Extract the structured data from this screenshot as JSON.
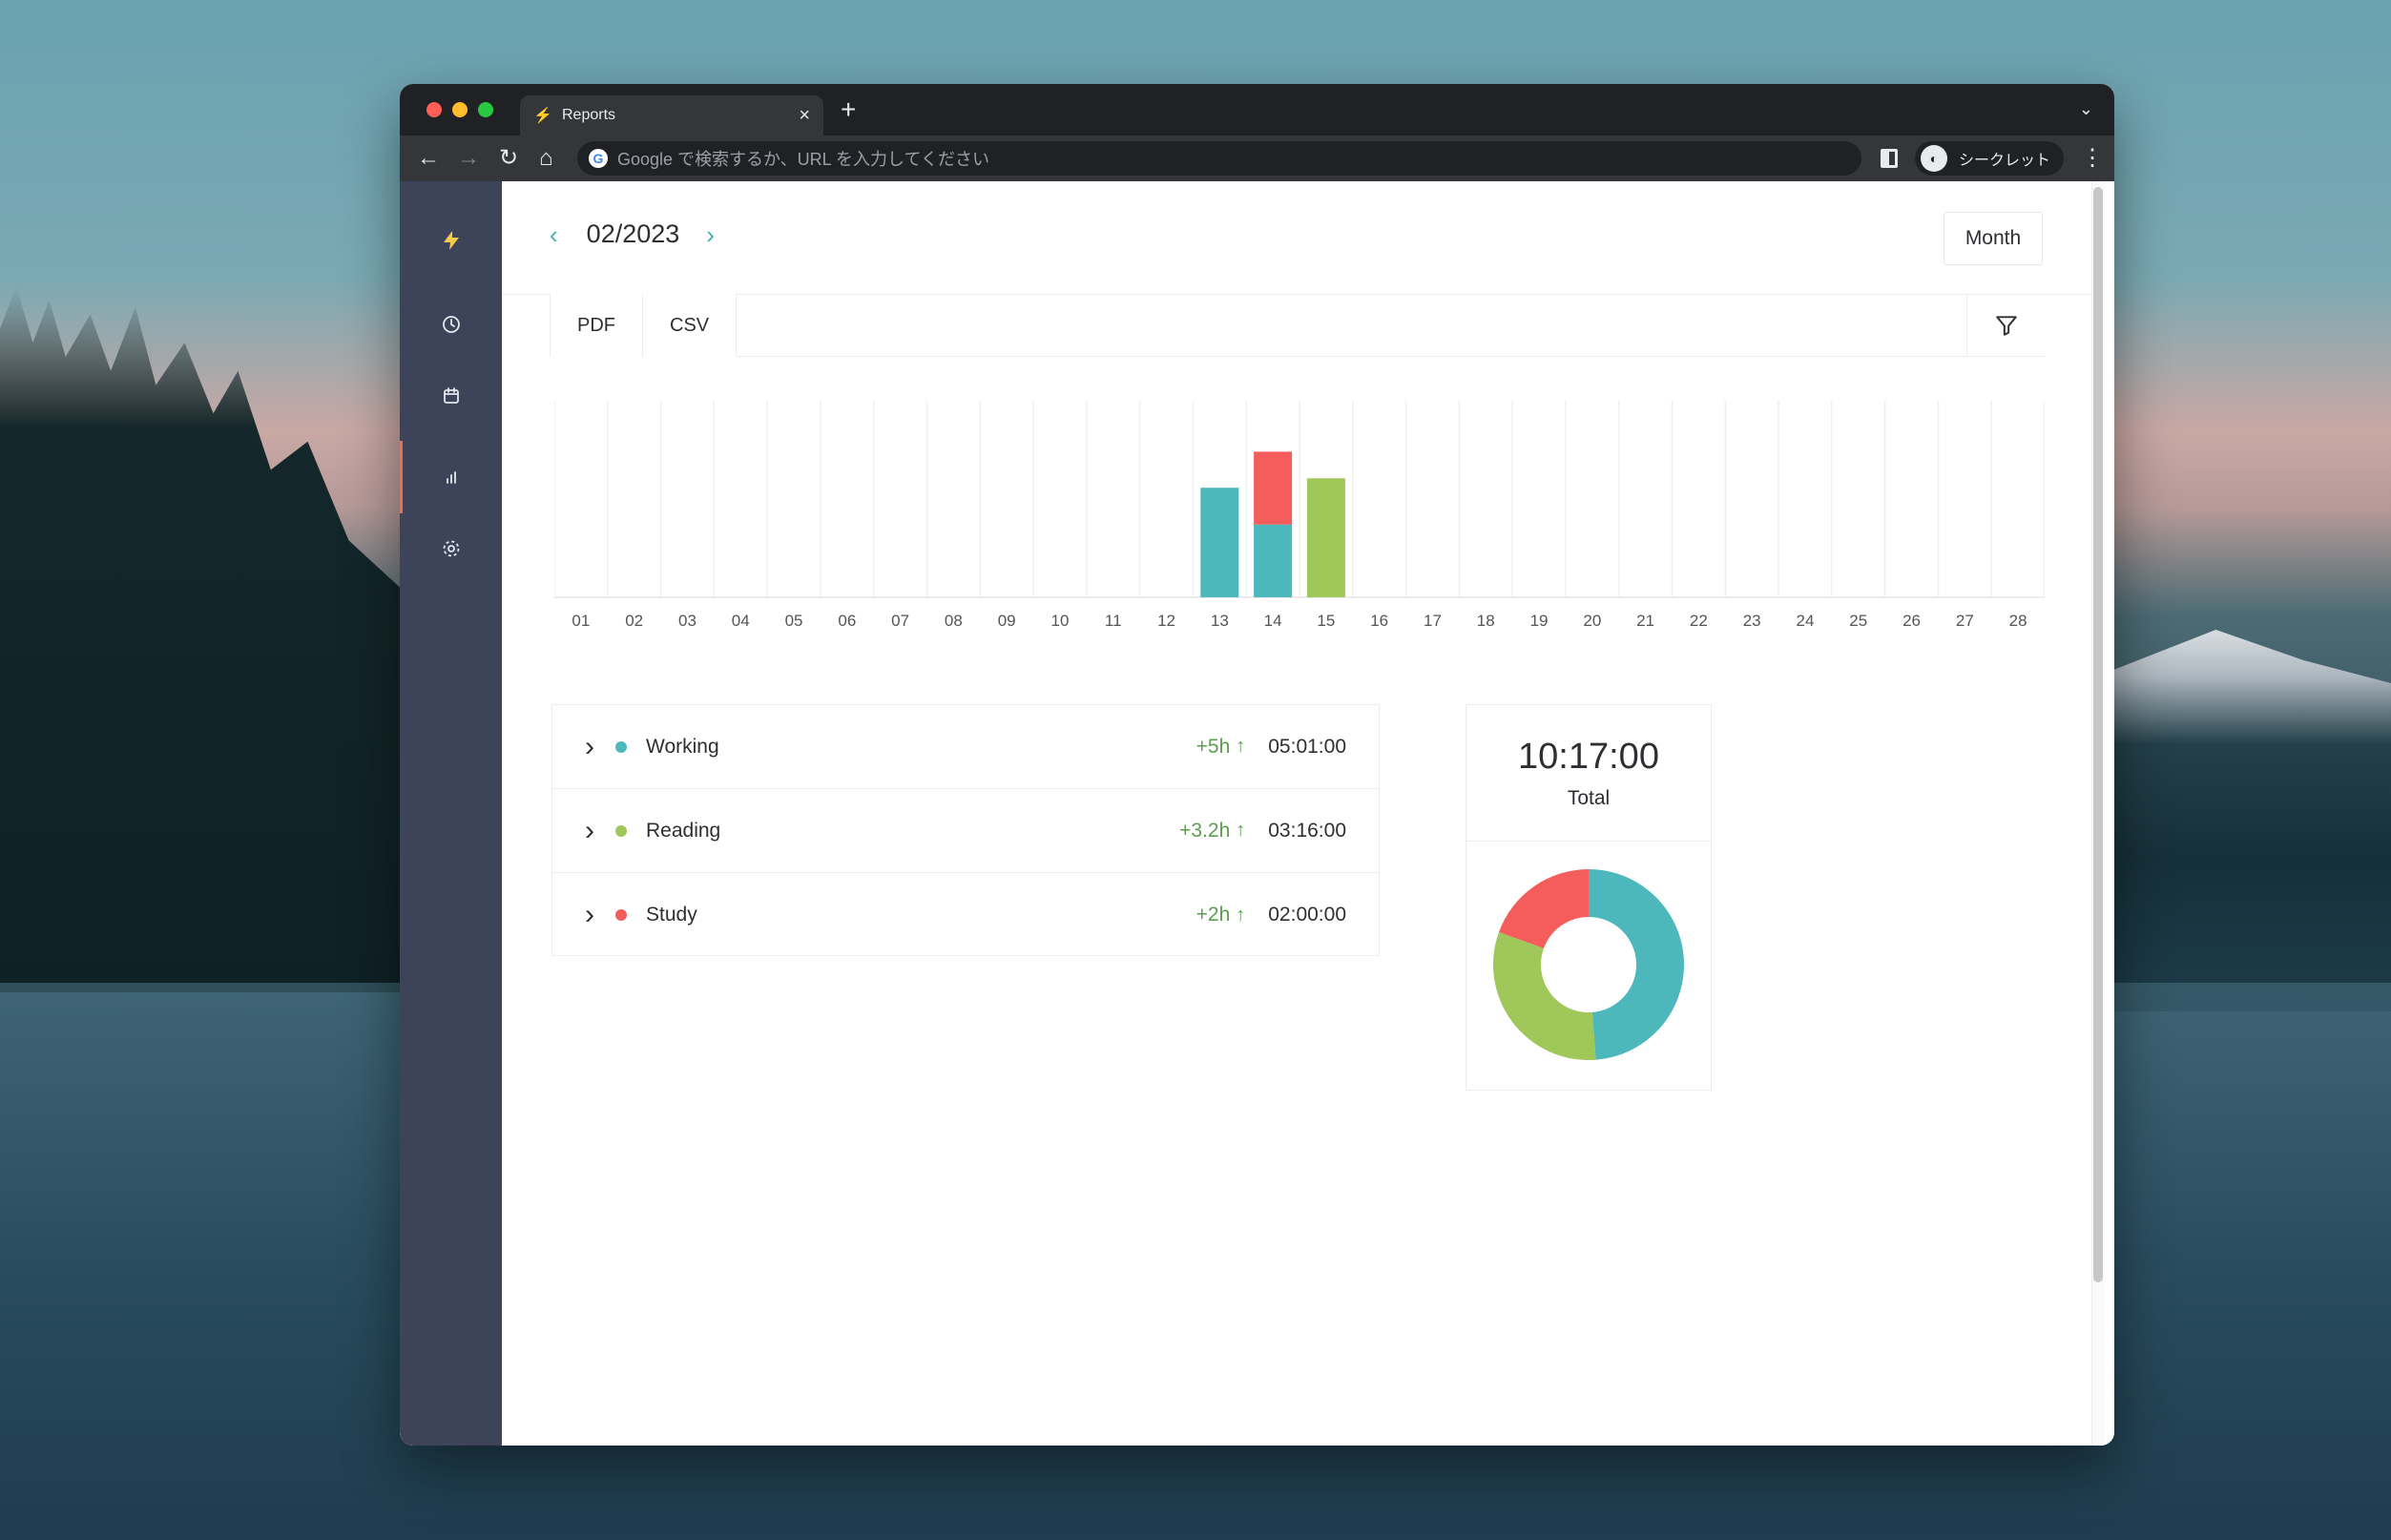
{
  "browser": {
    "tab_title": "Reports",
    "new_tab_symbol": "+",
    "close_symbol": "×",
    "omnibox_placeholder": "Google で検索するか、URL を入力してください",
    "profile_label": "シークレット"
  },
  "sidebar": {
    "items": [
      {
        "name": "logo",
        "icon": "lightning-icon"
      },
      {
        "name": "timer",
        "icon": "clock-icon"
      },
      {
        "name": "calendar",
        "icon": "calendar-icon"
      },
      {
        "name": "reports",
        "icon": "bar-chart-icon",
        "active": true
      },
      {
        "name": "settings",
        "icon": "gear-icon"
      }
    ]
  },
  "header": {
    "period": "02/2023",
    "prev_symbol": "‹",
    "next_symbol": "›",
    "view_mode": "Month"
  },
  "exports": {
    "pdf_label": "PDF",
    "csv_label": "CSV"
  },
  "colors": {
    "working": "#4cb8bc",
    "reading": "#a0c75a",
    "study": "#f55d5d",
    "accent": "#3cb0b8",
    "sidebar": "#3d4459",
    "logo": "#f7c948"
  },
  "chart_data": {
    "type": "bar",
    "stacked": true,
    "categories": [
      "01",
      "02",
      "03",
      "04",
      "05",
      "06",
      "07",
      "08",
      "09",
      "10",
      "11",
      "12",
      "13",
      "14",
      "15",
      "16",
      "17",
      "18",
      "19",
      "20",
      "21",
      "22",
      "23",
      "24",
      "25",
      "26",
      "27",
      "28"
    ],
    "series": [
      {
        "name": "Working",
        "values": [
          0,
          0,
          0,
          0,
          0,
          0,
          0,
          0,
          0,
          0,
          0,
          0,
          3.01,
          2.0,
          0,
          0,
          0,
          0,
          0,
          0,
          0,
          0,
          0,
          0,
          0,
          0,
          0,
          0
        ]
      },
      {
        "name": "Study",
        "values": [
          0,
          0,
          0,
          0,
          0,
          0,
          0,
          0,
          0,
          0,
          0,
          0,
          0,
          2.0,
          0,
          0,
          0,
          0,
          0,
          0,
          0,
          0,
          0,
          0,
          0,
          0,
          0,
          0
        ]
      },
      {
        "name": "Reading",
        "values": [
          0,
          0,
          0,
          0,
          0,
          0,
          0,
          0,
          0,
          0,
          0,
          0,
          0,
          0,
          3.27,
          0,
          0,
          0,
          0,
          0,
          0,
          0,
          0,
          0,
          0,
          0,
          0,
          0
        ]
      }
    ],
    "ylim": [
      0,
      5.4
    ],
    "grid": true
  },
  "activities": [
    {
      "name": "Working",
      "delta": "+5h",
      "time": "05:01:00",
      "color": "#4cb8bc"
    },
    {
      "name": "Reading",
      "delta": "+3.2h",
      "time": "03:16:00",
      "color": "#a0c75a"
    },
    {
      "name": "Study",
      "delta": "+2h",
      "time": "02:00:00",
      "color": "#f55d5d"
    }
  ],
  "total": {
    "value": "10:17:00",
    "label": "Total"
  },
  "donut_data": {
    "type": "pie",
    "slices": [
      {
        "name": "Working",
        "value": 301,
        "color": "#4cb8bc"
      },
      {
        "name": "Reading",
        "value": 196,
        "color": "#a0c75a"
      },
      {
        "name": "Study",
        "value": 120,
        "color": "#f55d5d"
      }
    ]
  }
}
